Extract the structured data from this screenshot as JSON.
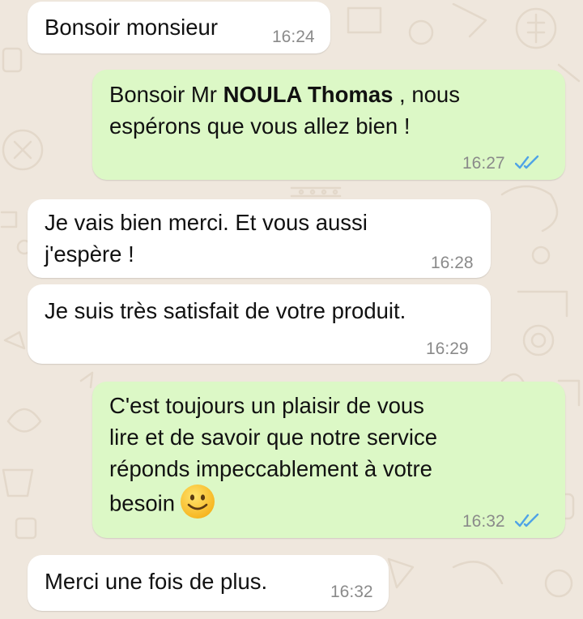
{
  "chat": {
    "messages": [
      {
        "direction": "incoming",
        "text": "Bonsoir monsieur",
        "time": "16:24"
      },
      {
        "direction": "outgoing",
        "line1_prefix": "Bonsoir Mr ",
        "line1_bold": "NOULA Thomas",
        "line1_suffix": " , nous",
        "line2": "espérons que vous allez bien !",
        "time": "16:27",
        "status_icon": "double-check-read-icon"
      },
      {
        "direction": "incoming",
        "line1": "Je vais bien merci. Et vous aussi",
        "line2": "j'espère !",
        "time": "16:28"
      },
      {
        "direction": "incoming",
        "text": "Je suis très satisfait de votre produit.",
        "time": "16:29"
      },
      {
        "direction": "outgoing",
        "line1": "C'est toujours un plaisir de vous",
        "line2": "lire et de savoir que notre service",
        "line3": "réponds impeccablement à votre",
        "line4": "besoin",
        "emoji": "slightly-smiling-face-emoji",
        "time": "16:32",
        "status_icon": "double-check-read-icon"
      },
      {
        "direction": "incoming",
        "text": "Merci une fois de plus.",
        "time": "16:32"
      }
    ]
  },
  "colors": {
    "wallpaper": "#efe7dd",
    "incoming_bubble": "#ffffff",
    "outgoing_bubble": "#dcf8c6",
    "read_ticks": "#4fa3e6",
    "timestamp": "#8a8a8a"
  }
}
